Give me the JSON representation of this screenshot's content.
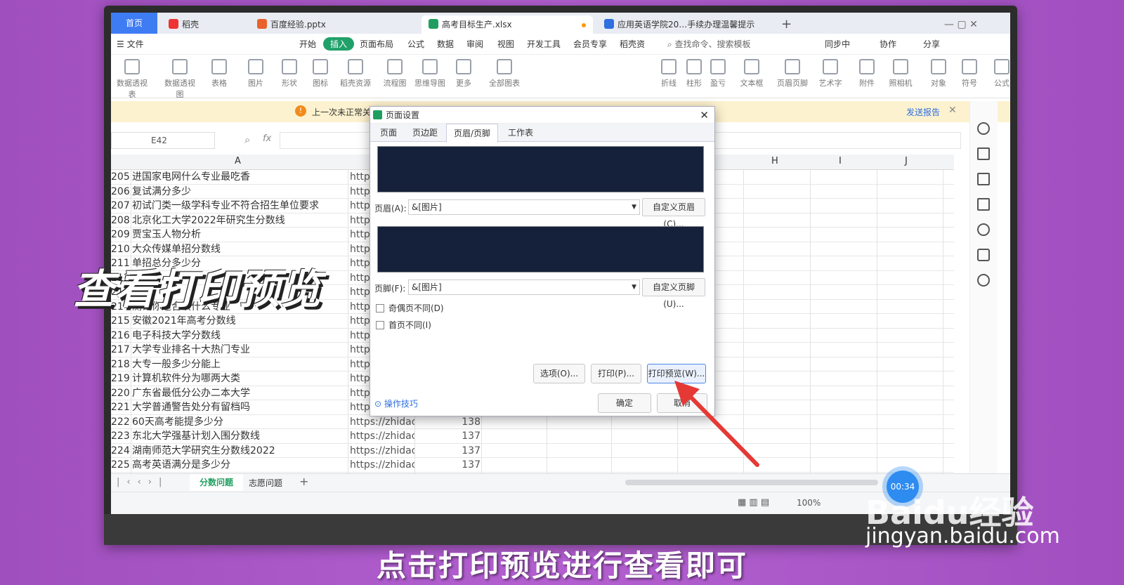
{
  "tabs": [
    {
      "label": "首页"
    },
    {
      "label": "稻壳"
    },
    {
      "label": "百度经验.pptx"
    },
    {
      "label": "高考目标生产.xlsx"
    },
    {
      "label": "应用英语学院20…手续办理温馨提示"
    }
  ],
  "menu": [
    "文件",
    "开始",
    "插入",
    "页面布局",
    "公式",
    "数据",
    "审阅",
    "视图",
    "开发工具",
    "会员专享",
    "稻壳资"
  ],
  "search_placeholder": "查找命令、搜索模板",
  "right_menu": [
    "同步中",
    "协作",
    "分享"
  ],
  "ribbon": [
    "数据透视表",
    "数据透视图",
    "表格",
    "图片",
    "形状",
    "图标",
    "稻壳资源",
    "流程图",
    "思维导图",
    "更多",
    "全部图表",
    "折线",
    "柱形",
    "盈亏",
    "文本框",
    "页眉页脚",
    "艺术字",
    "附件",
    "照相机",
    "对象",
    "符号",
    "公式"
  ],
  "notice": {
    "text": "上一次未正常关",
    "link": "发送报告"
  },
  "namebox": "E42",
  "fx": "fx",
  "col_headers": [
    "A",
    "H",
    "I",
    "J"
  ],
  "rows": [
    {
      "n": "205",
      "a": "进国家电网什么专业最吃香",
      "b": "http",
      "c": ""
    },
    {
      "n": "206",
      "a": "复试满分多少",
      "b": "http",
      "c": ""
    },
    {
      "n": "207",
      "a": "初试门类一级学科专业不符合招生单位要求",
      "b": "http",
      "c": ""
    },
    {
      "n": "208",
      "a": "北京化工大学2022年研究生分数线",
      "b": "http",
      "c": ""
    },
    {
      "n": "209",
      "a": "贾宝玉人物分析",
      "b": "http",
      "c": ""
    },
    {
      "n": "210",
      "a": "大众传媒单招分数线",
      "b": "http",
      "c": ""
    },
    {
      "n": "211",
      "a": "单招总分多少分",
      "b": "http",
      "c": ""
    },
    {
      "n": "212",
      "a": "",
      "b": "http",
      "c": ""
    },
    {
      "n": "213",
      "a": "",
      "b": "http",
      "c": ""
    },
    {
      "n": "214",
      "a": "测试你适合读什么专业",
      "b": "http",
      "c": ""
    },
    {
      "n": "215",
      "a": "安徽2021年高考分数线",
      "b": "http",
      "c": ""
    },
    {
      "n": "216",
      "a": "电子科技大学分数线",
      "b": "http",
      "c": ""
    },
    {
      "n": "217",
      "a": "大学专业排名十大热门专业",
      "b": "http",
      "c": ""
    },
    {
      "n": "218",
      "a": "大专一般多少分能上",
      "b": "http",
      "c": ""
    },
    {
      "n": "219",
      "a": "计算机软件分为哪两大类",
      "b": "http",
      "c": ""
    },
    {
      "n": "220",
      "a": "广东省最低分公办二本大学",
      "b": "http",
      "c": ""
    },
    {
      "n": "221",
      "a": "大学普通警告处分有留档吗",
      "b": "http",
      "c": ""
    },
    {
      "n": "222",
      "a": "60天高考能提多少分",
      "b": "https://zhidao",
      "c": "138"
    },
    {
      "n": "223",
      "a": "东北大学强基计划入围分数线",
      "b": "https://zhidao",
      "c": "137"
    },
    {
      "n": "224",
      "a": "湖南师范大学研究生分数线2022",
      "b": "https://zhidao",
      "c": "137"
    },
    {
      "n": "225",
      "a": "高考英语满分是多少分",
      "b": "https://zhidao",
      "c": "137"
    }
  ],
  "sheets": [
    "分数问题",
    "志愿问题"
  ],
  "zoom": "100%",
  "dialog": {
    "title": "页面设置",
    "tabs": [
      "页面",
      "页边距",
      "页眉/页脚",
      "工作表"
    ],
    "header_label": "页眉(A):",
    "header_value": "&[图片]",
    "header_btn": "自定义页眉(C)...",
    "footer_label": "页脚(F):",
    "footer_value": "&[图片]",
    "footer_btn": "自定义页脚(U)...",
    "check1": "奇偶页不同(D)",
    "check2": "首页不同(I)",
    "btn_options": "选项(O)...",
    "btn_print": "打印(P)...",
    "btn_preview": "打印预览(W)...",
    "tips": "操作技巧",
    "btn_ok": "确定",
    "btn_cancel": "取消"
  },
  "overlay_title": "查看打印预览",
  "caption": "点击打印预览进行查看即可",
  "timer": "00:34",
  "watermark": {
    "brand": "Baidu经验",
    "url": "jingyan.baidu.com"
  }
}
